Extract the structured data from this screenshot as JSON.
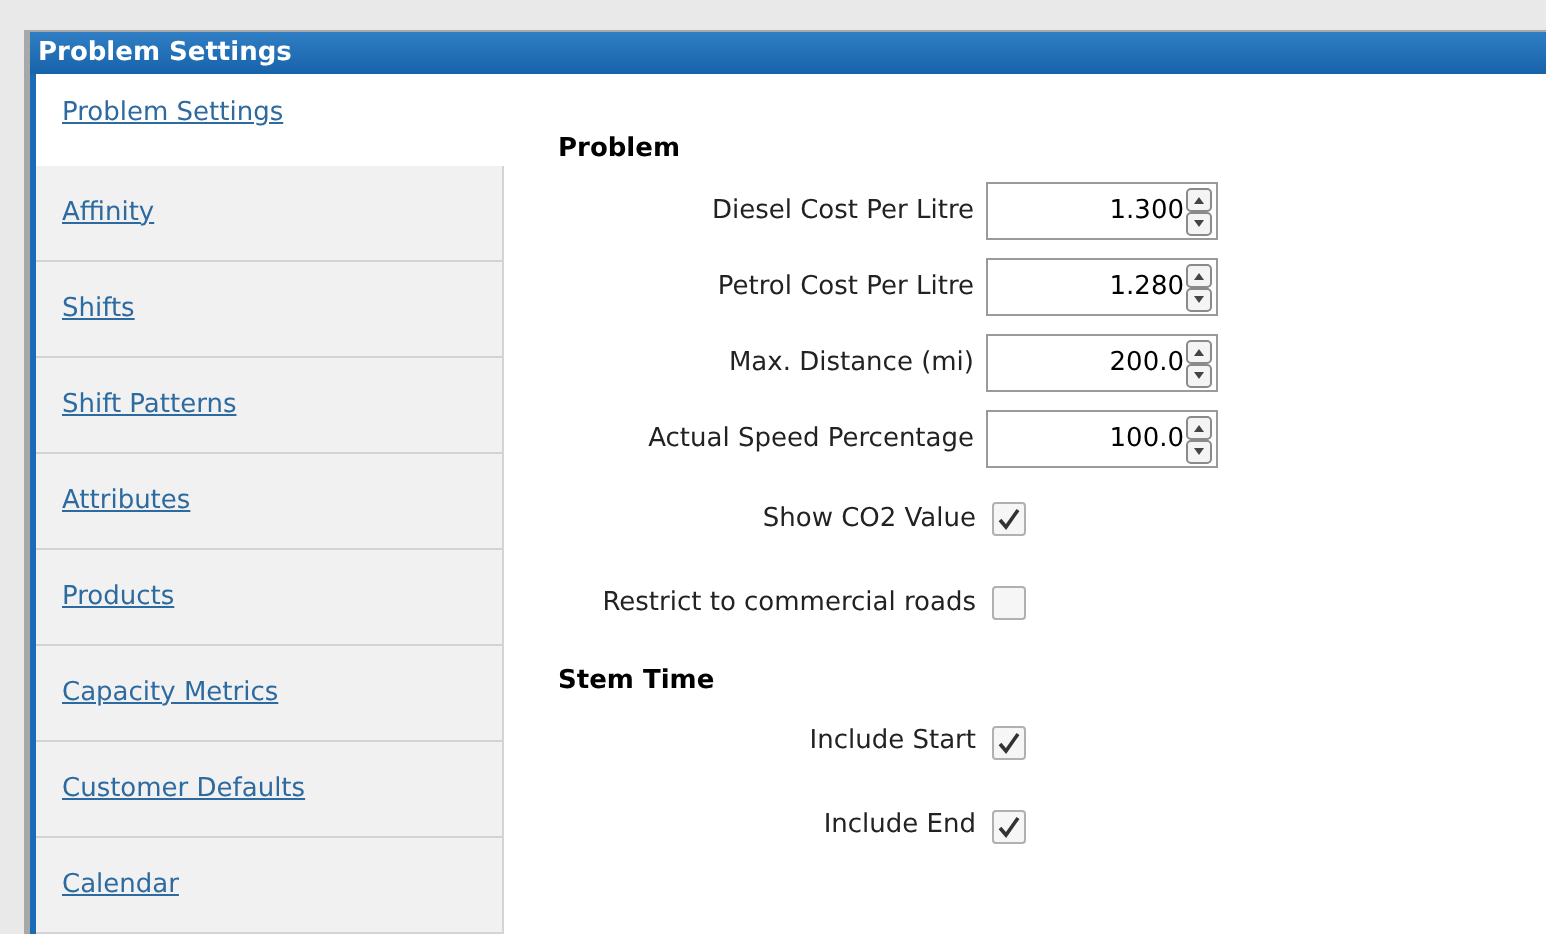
{
  "window": {
    "title": "Problem Settings"
  },
  "sidebar": {
    "items": [
      {
        "label": "Problem Settings",
        "selected": true
      },
      {
        "label": "Affinity",
        "selected": false
      },
      {
        "label": "Shifts",
        "selected": false
      },
      {
        "label": "Shift Patterns",
        "selected": false
      },
      {
        "label": "Attributes",
        "selected": false
      },
      {
        "label": "Products",
        "selected": false
      },
      {
        "label": "Capacity Metrics",
        "selected": false
      },
      {
        "label": "Customer Defaults",
        "selected": false
      },
      {
        "label": "Calendar",
        "selected": false
      }
    ]
  },
  "sections": [
    {
      "title": "Problem",
      "fields": [
        {
          "kind": "number",
          "label": "Diesel Cost Per Litre",
          "value": "1.300"
        },
        {
          "kind": "number",
          "label": "Petrol Cost Per Litre",
          "value": "1.280"
        },
        {
          "kind": "number",
          "label": "Max. Distance (mi)",
          "value": "200.0"
        },
        {
          "kind": "number",
          "label": "Actual Speed Percentage",
          "value": "100.0"
        },
        {
          "kind": "checkbox",
          "label": "Show CO2 Value",
          "checked": true
        },
        {
          "kind": "checkbox",
          "label": "Restrict to commercial roads",
          "checked": false
        }
      ]
    },
    {
      "title": "Stem Time",
      "fields": [
        {
          "kind": "checkbox",
          "label": "Include Start",
          "checked": true
        },
        {
          "kind": "checkbox",
          "label": "Include End",
          "checked": true
        }
      ]
    }
  ]
}
